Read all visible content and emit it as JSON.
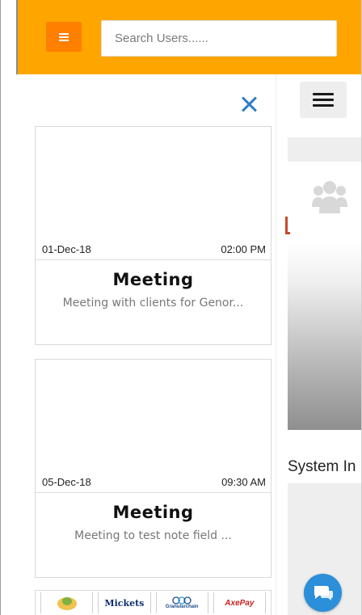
{
  "header": {
    "search_placeholder": "Search Users......"
  },
  "panel": {
    "cards": [
      {
        "date": "01-Dec-18",
        "time": "02:00 PM",
        "title": "Meeting",
        "description": "Meeting with clients for Genor..."
      },
      {
        "date": "05-Dec-18",
        "time": "09:30 AM",
        "title": "Meeting",
        "description": "Meeting to test note field ..."
      }
    ],
    "logos": [
      {
        "icon": "gingerbread-logo"
      },
      {
        "text": "Mickets"
      },
      {
        "text": "Granularchain"
      },
      {
        "text": "AxePay"
      }
    ]
  },
  "background": {
    "system_text": "System In"
  },
  "colors": {
    "topbar": "#FFA500",
    "menu_button": "#FF7F00",
    "close_icon": "#2E7DC5",
    "chat_button": "#2B8FD9"
  }
}
